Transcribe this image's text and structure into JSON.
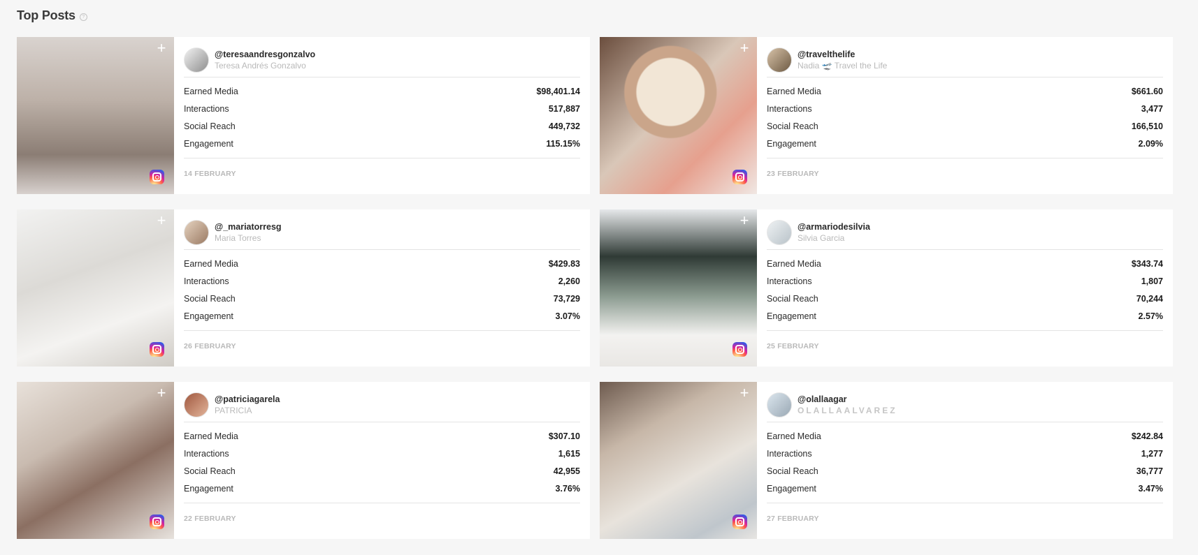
{
  "page": {
    "title": "Top Posts",
    "help_icon": "?"
  },
  "posts": [
    {
      "handle": "@teresaandresgonzalvo",
      "name": "Teresa Andrés Gonzalvo",
      "metrics": [
        {
          "label": "Earned Media",
          "value": "$98,401.14"
        },
        {
          "label": "Interactions",
          "value": "517,887"
        },
        {
          "label": "Social Reach",
          "value": "449,732"
        },
        {
          "label": "Engagement",
          "value": "115.15%"
        }
      ],
      "date": "14 FEBRUARY",
      "add_icon": "+"
    },
    {
      "handle": "@travelthelife",
      "name": "Nadia 🛫 Travel the Life",
      "metrics": [
        {
          "label": "Earned Media",
          "value": "$661.60"
        },
        {
          "label": "Interactions",
          "value": "3,477"
        },
        {
          "label": "Social Reach",
          "value": "166,510"
        },
        {
          "label": "Engagement",
          "value": "2.09%"
        }
      ],
      "date": "23 FEBRUARY",
      "add_icon": "+"
    },
    {
      "handle": "@_mariatorresg",
      "name": "Maria Torres",
      "metrics": [
        {
          "label": "Earned Media",
          "value": "$429.83"
        },
        {
          "label": "Interactions",
          "value": "2,260"
        },
        {
          "label": "Social Reach",
          "value": "73,729"
        },
        {
          "label": "Engagement",
          "value": "3.07%"
        }
      ],
      "date": "26 FEBRUARY",
      "add_icon": "+"
    },
    {
      "handle": "@armariodesilvia",
      "name": "Silvia Garcia",
      "metrics": [
        {
          "label": "Earned Media",
          "value": "$343.74"
        },
        {
          "label": "Interactions",
          "value": "1,807"
        },
        {
          "label": "Social Reach",
          "value": "70,244"
        },
        {
          "label": "Engagement",
          "value": "2.57%"
        }
      ],
      "date": "25 FEBRUARY",
      "add_icon": "+"
    },
    {
      "handle": "@patriciagarela",
      "name": "PATRICIA",
      "metrics": [
        {
          "label": "Earned Media",
          "value": "$307.10"
        },
        {
          "label": "Interactions",
          "value": "1,615"
        },
        {
          "label": "Social Reach",
          "value": "42,955"
        },
        {
          "label": "Engagement",
          "value": "3.76%"
        }
      ],
      "date": "22 FEBRUARY",
      "add_icon": "+"
    },
    {
      "handle": "@olallaagar",
      "name": "OLALLAALVAREZ",
      "metrics": [
        {
          "label": "Earned Media",
          "value": "$242.84"
        },
        {
          "label": "Interactions",
          "value": "1,277"
        },
        {
          "label": "Social Reach",
          "value": "36,777"
        },
        {
          "label": "Engagement",
          "value": "3.47%"
        }
      ],
      "date": "27 FEBRUARY",
      "add_icon": "+"
    }
  ]
}
